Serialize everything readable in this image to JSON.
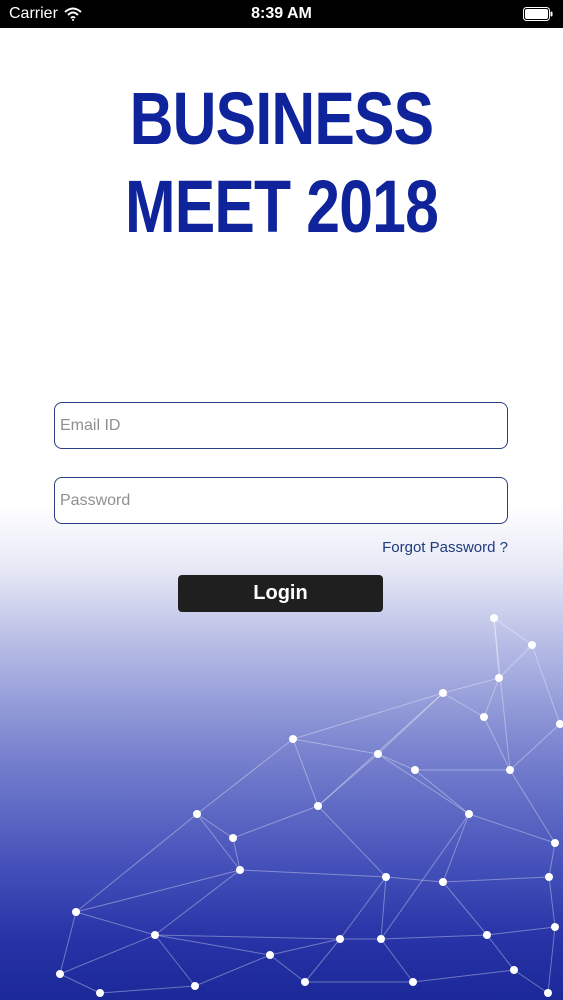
{
  "status_bar": {
    "carrier": "Carrier",
    "time": "8:39 AM",
    "icons": [
      "wifi-icon",
      "battery-icon"
    ]
  },
  "logo": {
    "line1": "BUSINESS",
    "line2": "MEET 2018",
    "color": "#0f239a"
  },
  "login_form": {
    "email_placeholder": "Email ID",
    "email_value": "",
    "password_placeholder": "Password",
    "password_value": "",
    "forgot_label": "Forgot Password ?",
    "login_label": "Login"
  },
  "colors": {
    "button_bg": "#1f1f1f",
    "background_blue": "#1b2898",
    "link": "#1f3a7a"
  }
}
